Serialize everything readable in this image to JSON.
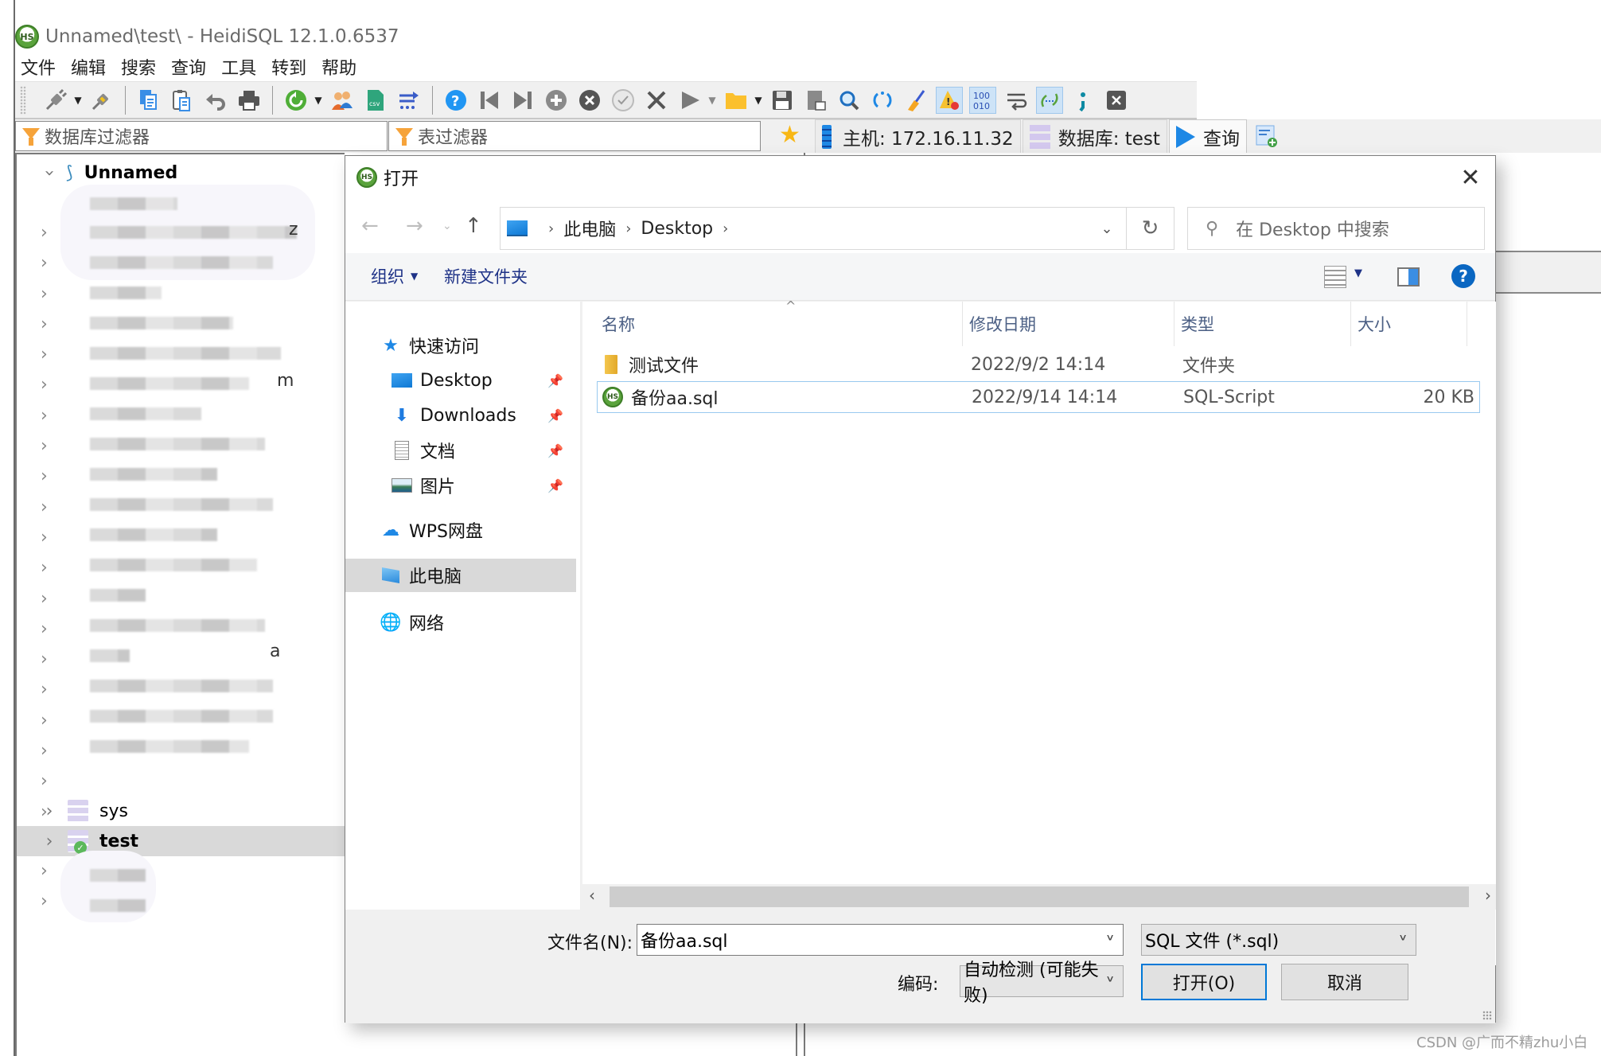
{
  "window": {
    "title": "Unnamed\\test\\ - HeidiSQL 12.1.0.6537",
    "logo_text": "HS"
  },
  "menu": [
    "文件",
    "编辑",
    "搜索",
    "查询",
    "工具",
    "转到",
    "帮助"
  ],
  "toolbar": {
    "icons": [
      "connect-icon",
      "dropdown-icon",
      "disconnect-icon",
      "copy-icon",
      "paste-icon",
      "undo-icon",
      "print-icon",
      "refresh-icon",
      "dropdown-icon",
      "user-manager-icon",
      "export-csv-icon",
      "data-transfer-icon",
      "help-icon",
      "first-record-icon",
      "last-record-icon",
      "insert-row-icon",
      "delete-row-icon",
      "post-icon",
      "cancel-icon",
      "execute-icon",
      "dropdown-icon",
      "open-folder-icon",
      "dropdown-icon",
      "save-icon",
      "save-snippet-icon",
      "find-icon",
      "replace-icon",
      "clean-icon",
      "warnings-icon",
      "binary-icon",
      "wrap-icon",
      "sql-help-icon",
      "semicolon-icon",
      "close-tab-icon"
    ],
    "csv_label": "csv",
    "binary_label": "100\n010"
  },
  "filters": {
    "db_filter_placeholder": "数据库过滤器",
    "table_filter_placeholder": "表过滤器"
  },
  "tabs": [
    {
      "label": "主机: 172.16.11.32",
      "icon": "server-icon"
    },
    {
      "label": "数据库: test",
      "icon": "database-icon"
    },
    {
      "label": "查询",
      "icon": "play-icon",
      "active": true
    }
  ],
  "tree": {
    "root": "Unnamed",
    "visible_items": [
      "sys",
      "test"
    ],
    "selected": "test",
    "partial_labels": [
      "z",
      "m",
      "a"
    ]
  },
  "dialog": {
    "title": "打开",
    "breadcrumb": [
      "此电脑",
      "Desktop"
    ],
    "search_placeholder": "在 Desktop 中搜索",
    "organize_label": "组织",
    "new_folder_label": "新建文件夹",
    "nav": {
      "quick_access": "快速访问",
      "pinned": [
        "Desktop",
        "Downloads",
        "文档",
        "图片"
      ],
      "wps": "WPS网盘",
      "this_pc": "此电脑",
      "network": "网络"
    },
    "columns": [
      "名称",
      "修改日期",
      "类型",
      "大小"
    ],
    "files": [
      {
        "name": "测试文件",
        "date": "2022/9/2 14:14",
        "type": "文件夹",
        "size": "",
        "kind": "folder"
      },
      {
        "name": "备份aa.sql",
        "date": "2022/9/14 14:14",
        "type": "SQL-Script",
        "size": "20 KB",
        "kind": "sql",
        "selected": true
      }
    ],
    "filename_label": "文件名(N):",
    "filename_value": "备份aa.sql",
    "filetype_value": "SQL 文件 (*.sql)",
    "encoding_label": "编码:",
    "encoding_value": "自动检测 (可能失败)",
    "open_button": "打开(O)",
    "cancel_button": "取消"
  },
  "watermark": "CSDN @广而不精zhu小白"
}
